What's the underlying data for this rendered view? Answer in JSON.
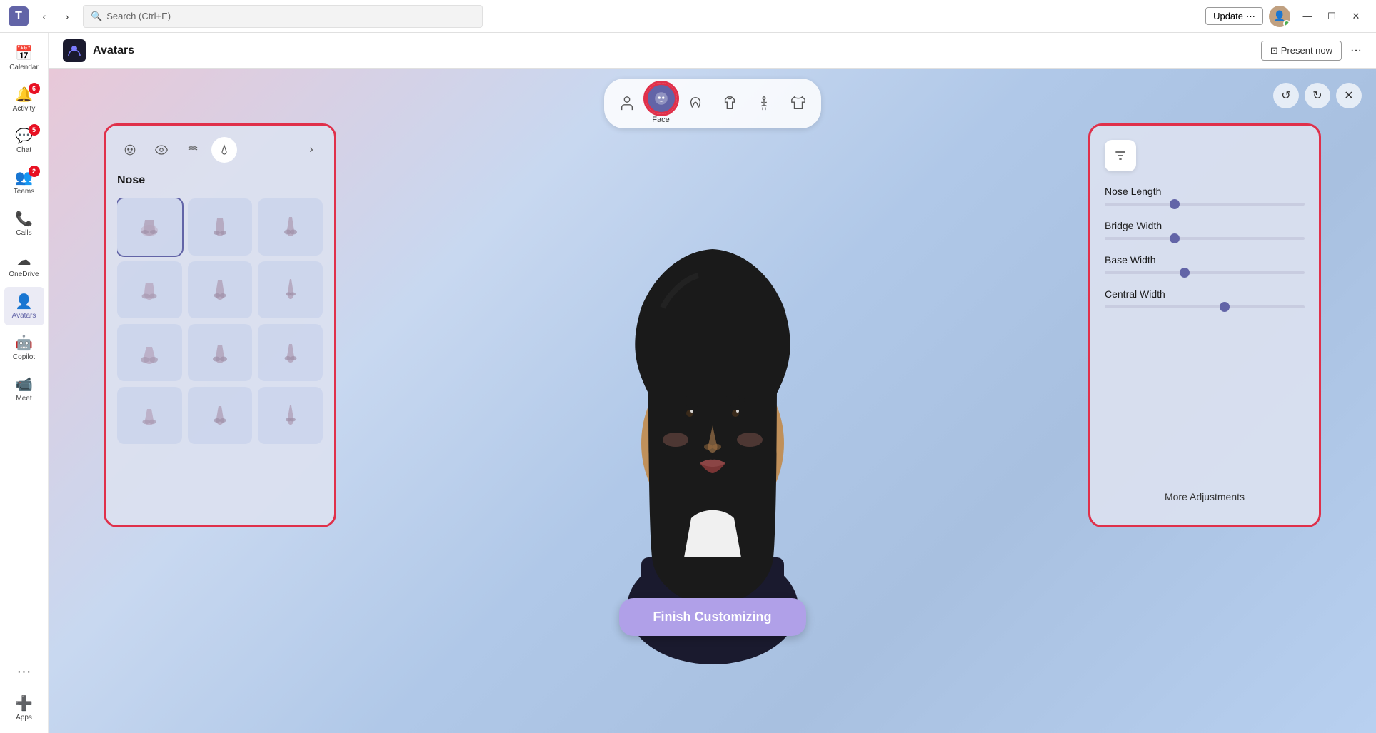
{
  "titlebar": {
    "logo": "T",
    "search_placeholder": "Search (Ctrl+E)",
    "update_label": "Update",
    "update_dots": "···",
    "minimize": "—",
    "maximize": "☐",
    "close": "✕"
  },
  "sidebar": {
    "items": [
      {
        "id": "calendar",
        "label": "Calendar",
        "icon": "📅",
        "badge": null,
        "active": false
      },
      {
        "id": "activity",
        "label": "Activity",
        "icon": "🔔",
        "badge": "6",
        "active": false
      },
      {
        "id": "chat",
        "label": "Chat",
        "icon": "💬",
        "badge": "5",
        "active": false
      },
      {
        "id": "teams",
        "label": "Teams",
        "icon": "👥",
        "badge": "2",
        "active": false
      },
      {
        "id": "calls",
        "label": "Calls",
        "icon": "📞",
        "badge": null,
        "active": false
      },
      {
        "id": "onedrive",
        "label": "OneDrive",
        "icon": "☁",
        "badge": null,
        "active": false
      },
      {
        "id": "avatars",
        "label": "Avatars",
        "icon": "👤",
        "badge": null,
        "active": true
      },
      {
        "id": "copilot",
        "label": "Copilot",
        "icon": "⬜",
        "badge": null,
        "active": false
      },
      {
        "id": "meet",
        "label": "Meet",
        "icon": "📹",
        "badge": null,
        "active": false
      },
      {
        "id": "more",
        "label": "···",
        "icon": "···",
        "badge": null,
        "active": false
      },
      {
        "id": "apps",
        "label": "Apps",
        "icon": "➕",
        "badge": null,
        "active": false
      }
    ]
  },
  "app_header": {
    "icon": "👾",
    "title": "Avatars",
    "present_now": "Present now",
    "more": "···"
  },
  "toolbar": {
    "tabs": [
      {
        "id": "body",
        "icon": "🧍",
        "label": "",
        "active": false
      },
      {
        "id": "face",
        "icon": "😊",
        "label": "Face",
        "active": true
      },
      {
        "id": "hair",
        "icon": "👩",
        "label": "",
        "active": false
      },
      {
        "id": "outfit",
        "icon": "👔",
        "label": "",
        "active": false
      },
      {
        "id": "pose",
        "icon": "🙆",
        "label": "",
        "active": false
      },
      {
        "id": "clothing",
        "icon": "👕",
        "label": "",
        "active": false
      }
    ],
    "undo": "↺",
    "redo": "↻",
    "close": "✕"
  },
  "left_panel": {
    "title": "Nose",
    "tabs": [
      {
        "id": "face-shape",
        "icon": "😊"
      },
      {
        "id": "eyes",
        "icon": "👁"
      },
      {
        "id": "eyebrows",
        "icon": "〰"
      },
      {
        "id": "nose",
        "icon": "👃",
        "active": true
      },
      {
        "id": "next",
        "icon": "›"
      }
    ],
    "items": [
      {
        "id": 1
      },
      {
        "id": 2
      },
      {
        "id": 3
      },
      {
        "id": 4
      },
      {
        "id": 5
      },
      {
        "id": 6
      },
      {
        "id": 7
      },
      {
        "id": 8
      },
      {
        "id": 9
      },
      {
        "id": 10
      },
      {
        "id": 11
      },
      {
        "id": 12
      }
    ]
  },
  "right_panel": {
    "sliders": [
      {
        "id": "nose-length",
        "label": "Nose Length",
        "value": 35
      },
      {
        "id": "bridge-width",
        "label": "Bridge Width",
        "value": 35
      },
      {
        "id": "base-width",
        "label": "Base Width",
        "value": 40
      },
      {
        "id": "central-width",
        "label": "Central Width",
        "value": 60
      }
    ],
    "more_adjustments": "More Adjustments"
  },
  "finish_btn": {
    "label": "Finish Customizing"
  }
}
